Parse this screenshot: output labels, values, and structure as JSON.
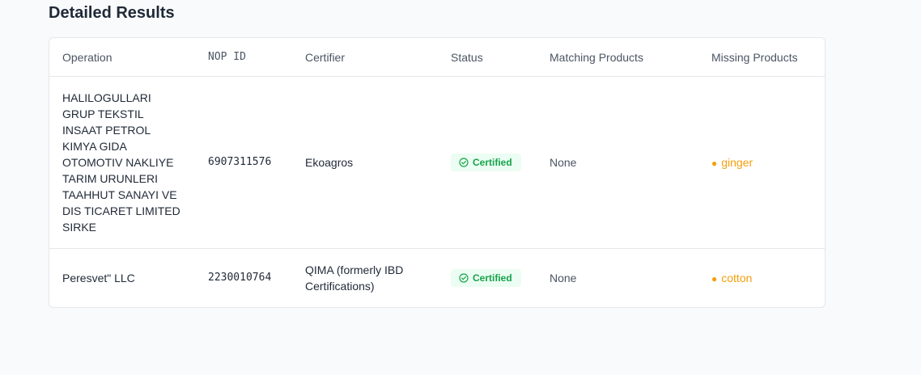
{
  "section": {
    "title": "Detailed Results"
  },
  "table": {
    "headers": {
      "operation": "Operation",
      "nop_id": "NOP ID",
      "certifier": "Certifier",
      "status": "Status",
      "matching_products": "Matching Products",
      "missing_products": "Missing Products"
    },
    "rows": [
      {
        "operation": "HALILOGULLARI GRUP TEKSTIL INSAAT PETROL KIMYA GIDA OTOMOTIV NAKLIYE TARIM URUNLERI TAAHHUT SANAYI VE DIS TICARET LIMITED SIRKE",
        "nop_id": "6907311576",
        "certifier": "Ekoagros",
        "status": "Certified",
        "matching_products": "None",
        "missing_products": [
          "ginger"
        ]
      },
      {
        "operation": "Peresvet\" LLC",
        "nop_id": "2230010764",
        "certifier": "QIMA (formerly IBD Certifications)",
        "status": "Certified",
        "matching_products": "None",
        "missing_products": [
          "cotton"
        ]
      }
    ]
  },
  "colors": {
    "certified_badge_bg": "#ecfdf3",
    "certified_badge_text": "#16a34a",
    "missing_product": "#f59e0b"
  },
  "icons": {
    "status": "check-circle-icon",
    "missing_bullet": "bullet"
  }
}
